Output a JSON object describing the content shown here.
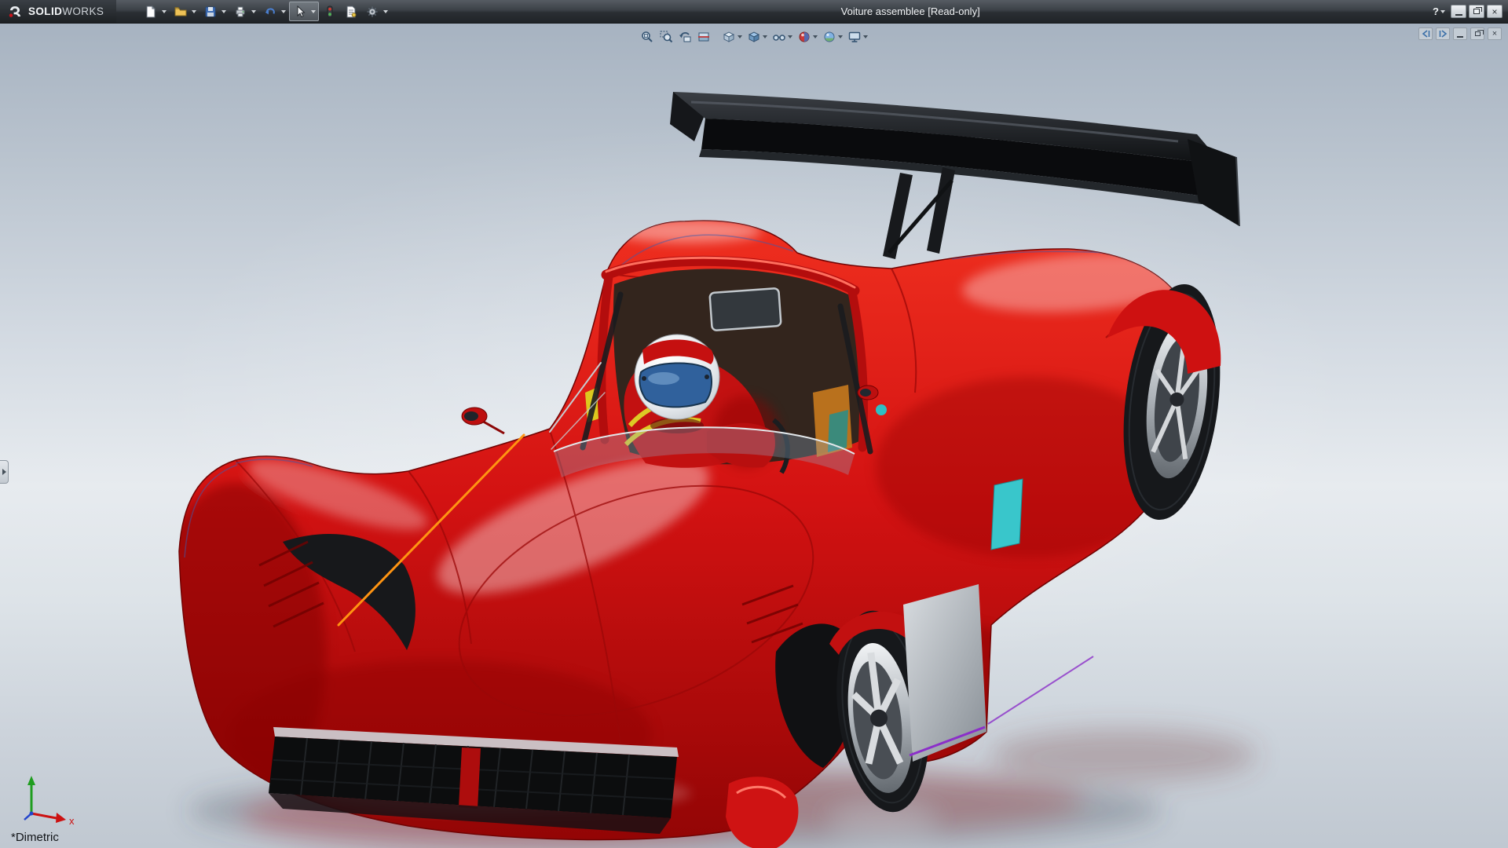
{
  "window": {
    "brand_bold": "SOLID",
    "brand_light": "WORKS",
    "title": "Voiture assemblee [Read-only]",
    "help_glyph": "?"
  },
  "titlebar_tools": {
    "items": [
      {
        "name": "new",
        "dropdown": true
      },
      {
        "name": "open",
        "dropdown": true
      },
      {
        "name": "save",
        "dropdown": true
      },
      {
        "name": "print",
        "dropdown": true
      },
      {
        "name": "undo",
        "dropdown": true
      },
      {
        "name": "select",
        "dropdown": true,
        "active": true
      },
      {
        "name": "rebuild",
        "dropdown": false
      },
      {
        "name": "file-properties",
        "dropdown": false
      },
      {
        "name": "options",
        "dropdown": true
      }
    ]
  },
  "window_controls": {
    "buttons": [
      "minimize",
      "restore",
      "close"
    ]
  },
  "doc_controls": {
    "buttons": [
      "pane-collapse",
      "pane-expand",
      "minimize",
      "restore",
      "close"
    ]
  },
  "view_toolbar": {
    "buttons": [
      "zoom-to-fit",
      "zoom-to-area",
      "previous-view",
      "section-view",
      "view-orientation",
      "display-style",
      "hide-show-items",
      "edit-appearance",
      "apply-scene",
      "view-settings"
    ]
  },
  "viewport": {
    "orientation_label": "*Dimetric",
    "triad_x_label": "x"
  },
  "icons": {
    "close_glyph": "×"
  },
  "colors": {
    "car_red": "#d31212",
    "wing_black": "#101214",
    "sketch_orange": "#ff9412",
    "titlebar": "#33383e",
    "background_top": "#a7b3c1",
    "background_mid": "#e7ebef",
    "background_bottom": "#c0c8d1"
  }
}
